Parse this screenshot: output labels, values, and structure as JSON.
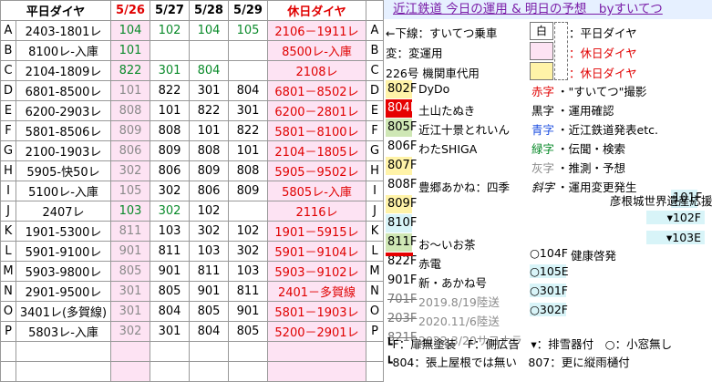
{
  "header": {
    "label": "平日ダイヤ",
    "d1": "5/26",
    "d2": "5/27",
    "d3": "5/28",
    "d4": "5/29",
    "holiday": "休日ダイヤ"
  },
  "rows": [
    {
      "id": "A",
      "train": "2403-1801レ",
      "d1": "104",
      "d2": "102",
      "d3": "104",
      "d4": "105",
      "hol": "2106－1911レ",
      "id2": "A"
    },
    {
      "id": "B",
      "train": "8100レ-入庫",
      "d1": "101",
      "d2": "",
      "d3": "",
      "d4": "",
      "hol": "8500レ-入庫",
      "id2": "B"
    },
    {
      "id": "C",
      "train": "2104-1809レ",
      "d1": "822",
      "d2": "301",
      "d3": "804",
      "d4": "",
      "hol": "2108レ",
      "id2": "C"
    },
    {
      "id": "D",
      "train": "6801-8500レ",
      "d1": "101",
      "d2": "822",
      "d3": "301",
      "d4": "804",
      "hol": "6801－8502レ",
      "id2": "D"
    },
    {
      "id": "E",
      "train": "6200-2903レ",
      "d1": "808",
      "d2": "101",
      "d3": "822",
      "d4": "301",
      "hol": "6200－2801レ",
      "id2": "E"
    },
    {
      "id": "F",
      "train": "5801-8506レ",
      "d1": "809",
      "d2": "808",
      "d3": "101",
      "d4": "822",
      "hol": "5801－8100レ",
      "id2": "F"
    },
    {
      "id": "G",
      "train": "2100-1903レ",
      "d1": "806",
      "d2": "809",
      "d3": "808",
      "d4": "101",
      "hol": "2104－1805レ",
      "id2": "G"
    },
    {
      "id": "H",
      "train": "5905-快50レ",
      "d1": "302",
      "d2": "806",
      "d3": "809",
      "d4": "808",
      "hol": "5905－9502レ",
      "id2": "H"
    },
    {
      "id": "I",
      "train": "5100レ-入庫",
      "d1": "105",
      "d2": "302",
      "d3": "806",
      "d4": "809",
      "hol": "5805レ-入庫",
      "id2": "I"
    },
    {
      "id": "J",
      "train": "2407レ",
      "d1": "103",
      "d2": "302",
      "d3": "102",
      "d4": "",
      "hol": "2116レ",
      "id2": "J"
    },
    {
      "id": "K",
      "train": "1901-5300レ",
      "d1": "811",
      "d2": "103",
      "d3": "302",
      "d4": "102",
      "hol": "1901－5915レ",
      "id2": "K"
    },
    {
      "id": "L",
      "train": "5901-9100レ",
      "d1": "901",
      "d2": "811",
      "d3": "103",
      "d4": "302",
      "hol": "5901－9104レ",
      "id2": "L"
    },
    {
      "id": "M",
      "train": "5903-9800レ",
      "d1": "805",
      "d2": "901",
      "d3": "811",
      "d4": "103",
      "hol": "5903－9102レ",
      "id2": "M"
    },
    {
      "id": "N",
      "train": "2901-9500レ",
      "d1": "301",
      "d2": "805",
      "d3": "901",
      "d4": "811",
      "hol": "2401－多賀線",
      "id2": "N"
    },
    {
      "id": "O",
      "train": "3401レ(多賀線)",
      "d1": "301",
      "d2": "804",
      "d3": "805",
      "d4": "901",
      "hol": "5801－1903レ",
      "id2": "O"
    },
    {
      "id": "P",
      "train": "5803レ-入庫",
      "d1": "302",
      "d2": "301",
      "d3": "804",
      "d4": "805",
      "hol": "5200－2901レ",
      "id2": "P"
    }
  ],
  "right": {
    "title": "近江鉄道 今日の運用 & 明日の予想　byすいてつ",
    "l_underline": "←下線：すいてつ乗車",
    "l_hen": "変：変運用",
    "l_226": "226号 機関車代用",
    "shiro": "白",
    "wd": "：平日ダイヤ",
    "hd1": "：休日ダイヤ",
    "hd2": "：休日ダイヤ",
    "trains": [
      {
        "no": "802F",
        "name": "DyDo"
      },
      {
        "no": "804F",
        "name": "土山たぬき"
      },
      {
        "no": "805F",
        "name": "近江十景とれいん"
      },
      {
        "no": "806F",
        "name": "わたSHIGA"
      },
      {
        "no": "807F",
        "name": ""
      },
      {
        "no": "808F",
        "name": "豊郷あかね：四季"
      },
      {
        "no": "809F",
        "name": ""
      },
      {
        "no": "810F",
        "name": ""
      },
      {
        "no": "811F",
        "name": "お～いお茶"
      },
      {
        "no": "822F",
        "name": "赤電"
      },
      {
        "no": "901F",
        "name": "新・あかね号"
      },
      {
        "no": "701F",
        "name": "2019.8/19陸送"
      },
      {
        "no": "203F",
        "name": "2020.11/6陸送"
      },
      {
        "no": "821F",
        "name": "2022.3/20サヨナラ"
      }
    ],
    "legend": [
      {
        "k": "赤字",
        "v": "・\"すいてつ\"撮影"
      },
      {
        "k": "黒字",
        "v": "・運用確認"
      },
      {
        "k": "青字",
        "v": "・近江鉄道発表etc."
      },
      {
        "k": "緑字",
        "v": "・伝聞・検索"
      },
      {
        "k": "灰字",
        "v": "・推測・予想"
      },
      {
        "k": "斜字",
        "v": "・運用変更発生"
      }
    ],
    "r101": "101F",
    "r101t": "彦根城世界遺産応援号",
    "r102": "▾102F",
    "r103": "▾103E",
    "r104": "○104F",
    "r104t": "健康啓発",
    "r105": "○105E",
    "r301": "○301F",
    "r302": "○302F",
    "foot1": "┗F：扉無塗装　F：側広告　▾：排雪器付　○：小窓無し",
    "foot2": "┗804：張上屋根では無い　807：更に縦雨樋付"
  }
}
